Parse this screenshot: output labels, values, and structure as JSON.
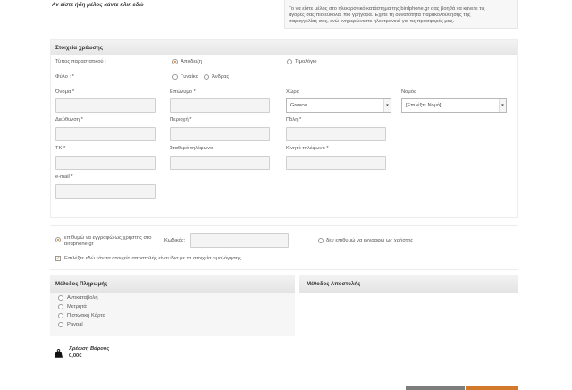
{
  "login_prompt": "Αν είστε ήδη μέλος κάντε κλικ εδώ",
  "info_text": {
    "line1": "Το να είστε μέλος στο ηλεκτρονικό κατάστημα της birdphone.gr σας βοηθά να κάνετε τις",
    "line2": "αγορές σας πιο εύκολα, πιο γρήγορα. Έχετε τη δυνατότητα παρακολούθησης της",
    "line3": "παραγγελίας σας, ενώ ενημερώνεστε ηλεκτρονικά για τις προσφορές μας."
  },
  "billing": {
    "title": "Στοιχεία χρέωσης",
    "doc_type_label": "Τύπος παραστατικού :",
    "doc_type_options": [
      "Απόδειξη",
      "Τιμολόγιο"
    ],
    "gender_label": "Φύλο : *",
    "gender_options": [
      "Γυναίκα",
      "Άνδρας"
    ],
    "fields": {
      "first_name": "Όνομα *",
      "last_name": "Επώνυμο *",
      "country": "Χώρα",
      "prefecture": "Νομός",
      "address": "Διεύθυνση *",
      "area": "Περιοχή *",
      "city": "Πόλη *",
      "zip": "ΤΚ *",
      "landline": "Σταθερό τηλέφωνο",
      "mobile": "Κινητό τηλέφωνο *",
      "email": "e-mail *"
    },
    "country_value": "Greece",
    "prefecture_value": "[Επιλέξτε Νομό]"
  },
  "account": {
    "register_line1": "επιθυμώ να εγγραφώ ως χρήστης στο",
    "register_line2": "birdphone.gr",
    "password_label": "Κωδικός:",
    "no_register": "δεν επιθυμώ να εγγραφώ ως χρήστης",
    "same_shipping": "Επιλέξτε εδώ εάν τα στοιχεία αποστολής είναι ίδια με τα στοιχεία τιμολόγησης"
  },
  "payment": {
    "title": "Μέθοδος Πληρωμής",
    "options": [
      "Αντικαταβολή",
      "Μετρητά",
      "Πιστωτική Κάρτα",
      "Paypal"
    ]
  },
  "shipping": {
    "title": "Μέθοδος Αποστολής"
  },
  "weight": {
    "label": "Χρέωση Βάρους",
    "value": "0,00€"
  }
}
